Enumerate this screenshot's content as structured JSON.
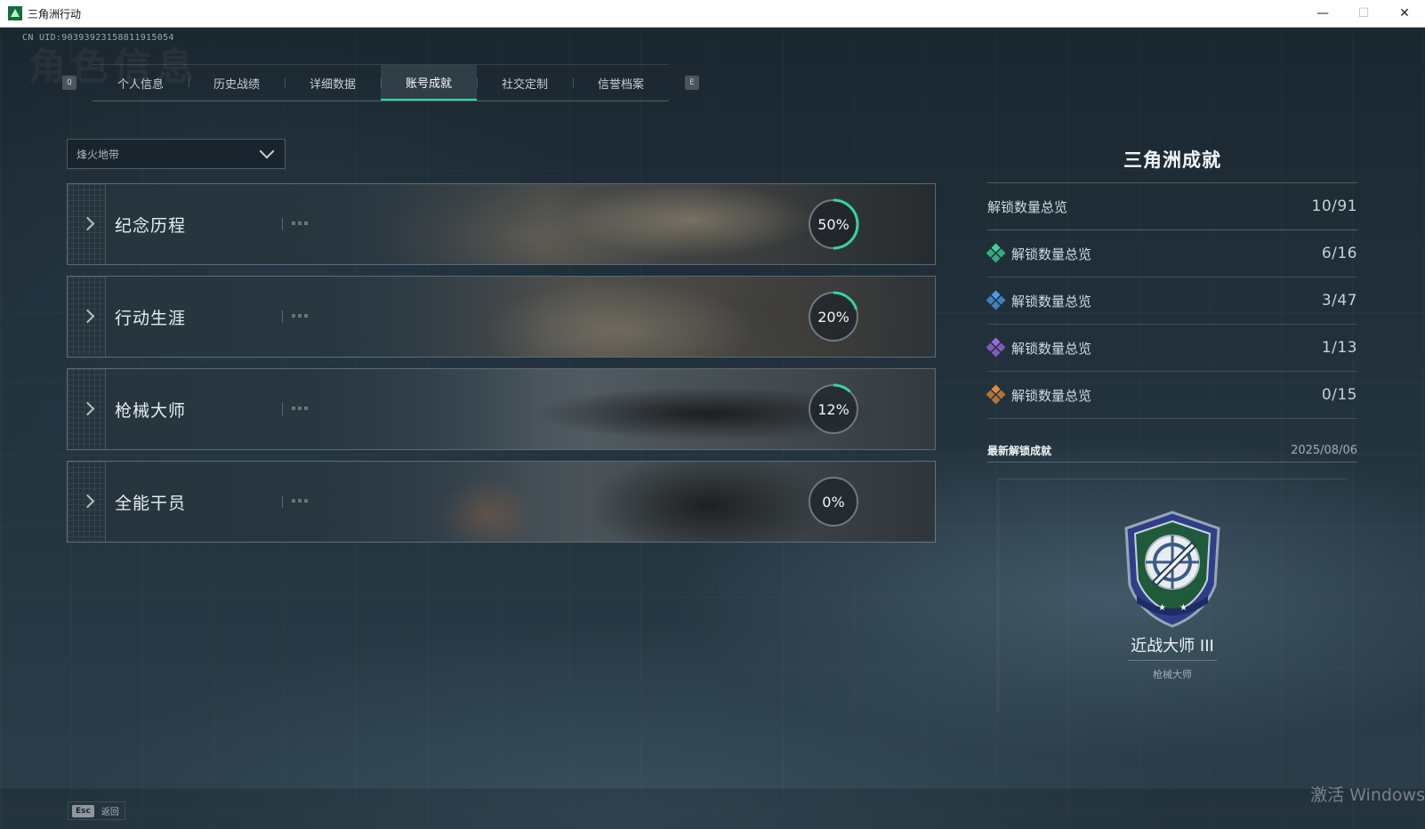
{
  "window": {
    "title": "三角洲行动"
  },
  "uid": "CN UID:9039392315881191505​4",
  "tabs": {
    "left_key": "Q",
    "right_key": "E",
    "items": [
      "个人信息",
      "历史战绩",
      "详细数据",
      "账号成就",
      "社交定制",
      "信誉档案"
    ],
    "active": "账号成就"
  },
  "filter": {
    "selected": "烽火地带"
  },
  "achievements": [
    {
      "title": "纪念历程",
      "progress_label": "50%",
      "progress": 0.5
    },
    {
      "title": "行动生涯",
      "progress_label": "20%",
      "progress": 0.2
    },
    {
      "title": "枪械大师",
      "progress_label": "12%",
      "progress": 0.12
    },
    {
      "title": "全能干员",
      "progress_label": "0%",
      "progress": 0
    }
  ],
  "panel": {
    "title": "三角洲成就",
    "stats": [
      {
        "label": "解锁数量总览",
        "value": "10/91",
        "icon": ""
      },
      {
        "label": "解锁数量总览",
        "value": "6/16",
        "icon": "green-gem-icon",
        "color": "#3fd39b"
      },
      {
        "label": "解锁数量总览",
        "value": "3/47",
        "icon": "blue-gem-icon",
        "color": "#4d9be8"
      },
      {
        "label": "解锁数量总览",
        "value": "1/13",
        "icon": "purple-gem-icon",
        "color": "#9b6be6"
      },
      {
        "label": "解锁数量总览",
        "value": "0/15",
        "icon": "orange-gem-icon",
        "color": "#e08a3c"
      }
    ],
    "latest": {
      "heading": "最新解锁成就",
      "date": "2025/08/06",
      "badge_name": "近战大师 III",
      "badge_category": "枪械大师"
    }
  },
  "footer": {
    "esc_key": "Esc",
    "esc_label": "返回"
  },
  "os_watermark": "激活 Windows",
  "colors": {
    "accent": "#36d4a3",
    "ring_track": "#6e7a80"
  }
}
